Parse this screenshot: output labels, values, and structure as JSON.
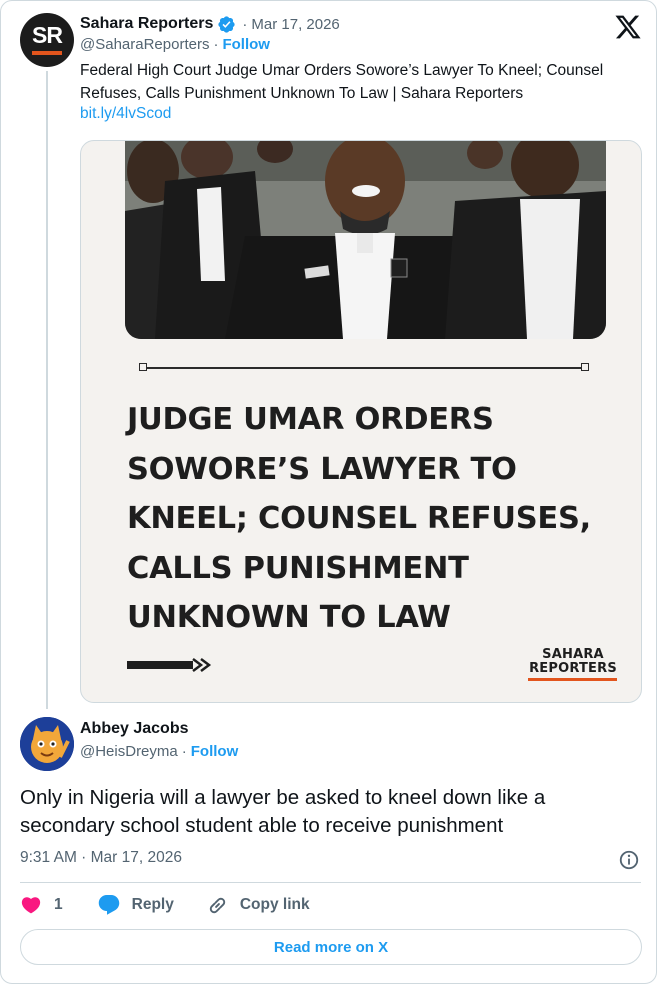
{
  "parent_tweet": {
    "author_name": "Sahara Reporters",
    "avatar_text": "SR",
    "verified": true,
    "date_separator": "·",
    "date": "Mar 17, 2026",
    "handle": "@SaharaReporters",
    "follow_separator": "·",
    "follow_label": "Follow",
    "text": "Federal High Court Judge Umar Orders Sowore’s Lawyer To Kneel; Counsel Refuses, Calls Punishment Unknown To Law | Sahara Reporters",
    "link": "bit.ly/4lvScod",
    "media": {
      "headline": "JUDGE UMAR ORDERS SOWORE’S LAWYER TO KNEEL; COUNSEL REFUSES, CALLS PUNISHMENT UNKNOWN TO LAW",
      "brand_line1": "SAHARA",
      "brand_line2": "REPORTERS"
    }
  },
  "reply_tweet": {
    "author_name": "Abbey Jacobs",
    "handle": "@HeisDreyma",
    "follow_separator": "·",
    "follow_label": "Follow",
    "text": "Only in Nigeria will a lawyer be asked to kneel down like a secondary school student able to receive punishment",
    "timestamp": "9:31 AM · Mar 17, 2026"
  },
  "actions": {
    "like_count": "1",
    "reply_label": "Reply",
    "copy_link_label": "Copy link"
  },
  "read_more_label": "Read more on X",
  "icons": {
    "verified": "verified-badge-icon",
    "brand": "x-logo-icon",
    "like": "heart-icon",
    "reply": "speech-bubble-icon",
    "copy": "link-icon",
    "info": "info-icon"
  },
  "colors": {
    "accent": "#1d9bf0",
    "like": "#f91880",
    "text": "#0f1419",
    "muted": "#536471",
    "border": "#cfd9de",
    "brand_orange": "#e2551d"
  }
}
